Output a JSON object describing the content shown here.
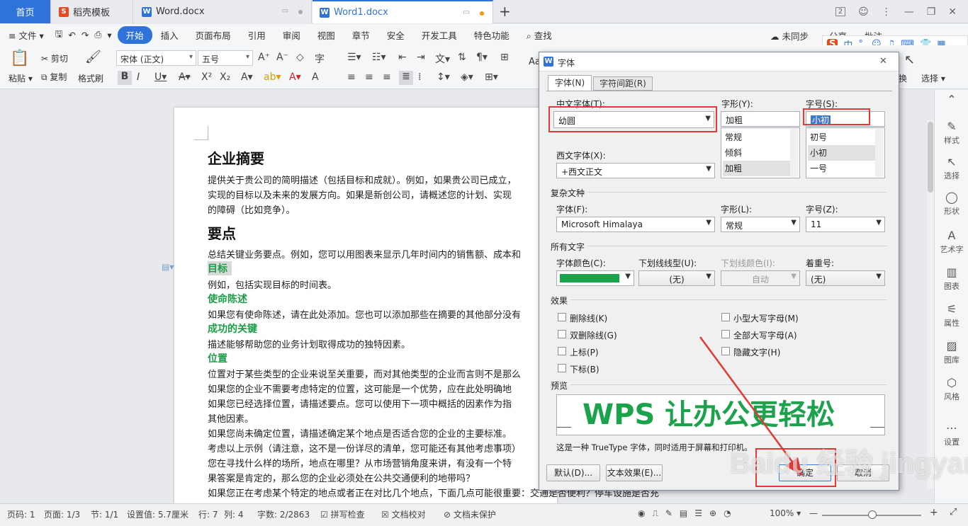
{
  "tabs": {
    "home": "首页",
    "template": "稻壳模板",
    "doc1": "Word.docx",
    "doc2": "Word1.docx",
    "new_tab": "+"
  },
  "window": {
    "badge": "2"
  },
  "menu": {
    "file": "文件",
    "items": [
      "开始",
      "插入",
      "页面布局",
      "引用",
      "审阅",
      "视图",
      "章节",
      "安全",
      "开发工具",
      "特色功能"
    ],
    "search": "查找",
    "sync": "未同步",
    "share": "分享",
    "comment": "批注"
  },
  "ribbon": {
    "paste": "粘贴",
    "cut": "剪切",
    "copy": "复制",
    "format_painter": "格式刷",
    "font_name": "宋体 (正文)",
    "font_size": "五号",
    "replace": "换",
    "select": "选择",
    "style_preview": "Aa"
  },
  "document": {
    "title1": "企业摘要",
    "p1_l1": "提供关于贵公司的简明描述（包括目标和成就）。例如，如果贵公司已成立，",
    "p1_l2": "实现的目标以及未来的发展方向。如果是新创公司，请概述您的计划、实现",
    "p1_l3": "的障碍（比如竞争）。",
    "title2": "要点",
    "p2": "总结关键业务要点。例如，您可以用图表来显示几年时间内的销售额、成本和",
    "h_goal": "目标",
    "p_goal": "例如，包括实现目标的时间表。",
    "h_mission": "使命陈述",
    "p_mission": "如果您有使命陈述，请在此处添加。您也可以添加那些在摘要的其他部分没有",
    "h_key": "成功的关键",
    "p_key": "描述能够帮助您的业务计划取得成功的独特因素。",
    "h_loc": "位置",
    "p_loc1": "位置对于某些类型的企业来说至关重要，而对其他类型的企业而言则不是那么",
    "p_loc2": "如果您的企业不需要考虑特定的位置，这可能是一个优势，应在此处明确地",
    "p_loc3": "如果您已经选择位置，请描述要点。您可以使用下一项中概括的因素作为指",
    "p_loc4": "其他因素。",
    "p_loc5": "如果您尚未确定位置，请描述确定某个地点是否适合您的企业的主要标准。",
    "p_loc6": "考虑以上示例（请注意，这不是一份详尽的清单，您可能还有其他考虑事项）",
    "p_loc7": "您在寻找什么样的场所，地点在哪里？从市场营销角度来讲，有没有一个特",
    "p_loc8": "果答案是肯定的，那么您的企业必须处在公共交通便利的地带吗？",
    "p_loc9": "如果您正在考虑某个特定的地点或者正在对比几个地点，下面几点可能很重要：交通是否便利？停车设施是否充"
  },
  "right_panel": [
    "样式",
    "选择",
    "形状",
    "艺术字",
    "图表",
    "属性",
    "图库",
    "风格",
    "设置"
  ],
  "status": {
    "page_num": "页码: 1",
    "pages": "页面: 1/3",
    "section": "节: 1/1",
    "setting": "设置值: 5.7厘米",
    "row": "行: 7",
    "col": "列: 4",
    "words": "字数: 2/2863",
    "spell": "拼写检查",
    "proof": "文档校对",
    "protect": "文档未保护",
    "zoom": "100%"
  },
  "dialog": {
    "title": "字体",
    "tab_font": "字体(N)",
    "tab_spacing": "字符间距(R)",
    "cn_font_label": "中文字体(T):",
    "cn_font_value": "幼圆",
    "style_label": "字形(Y):",
    "style_value": "加粗",
    "style_options": [
      "常规",
      "倾斜",
      "加粗"
    ],
    "size_label": "字号(S):",
    "size_value": "小初",
    "size_options": [
      "初号",
      "小初",
      "一号"
    ],
    "west_font_label": "西文字体(X):",
    "west_font_value": "+西文正文",
    "complex_section": "复杂文种",
    "complex_font_label": "字体(F):",
    "complex_font_value": "Microsoft Himalaya",
    "complex_style_label": "字形(L):",
    "complex_style_value": "常规",
    "complex_size_label": "字号(Z):",
    "complex_size_value": "11",
    "all_text_section": "所有文字",
    "color_label": "字体颜色(C):",
    "color_value": "#1aa34a",
    "underline_label": "下划线线型(U):",
    "underline_value": "(无)",
    "underline_color_label": "下划线颜色(I):",
    "underline_color_value": "自动",
    "emphasis_label": "着重号:",
    "emphasis_value": "(无)",
    "effects_section": "效果",
    "effects_left": [
      "删除线(K)",
      "双删除线(G)",
      "上标(P)",
      "下标(B)"
    ],
    "effects_right": [
      "小型大写字母(M)",
      "全部大写字母(A)",
      "隐藏文字(H)"
    ],
    "preview_section": "预览",
    "preview_text": "WPS 让办公更轻松",
    "preview_note": "这是一种 TrueType 字体，同时适用于屏幕和打印机。",
    "btn_default": "默认(D)...",
    "btn_text_effect": "文本效果(E)...",
    "btn_ok": "确定",
    "btn_cancel": "取消"
  },
  "watermark": "Baidu 经验 jingyan.baidu.com",
  "colors": {
    "accent": "#2f73d9",
    "highlight": "#e53935",
    "green": "#1aa34a"
  }
}
